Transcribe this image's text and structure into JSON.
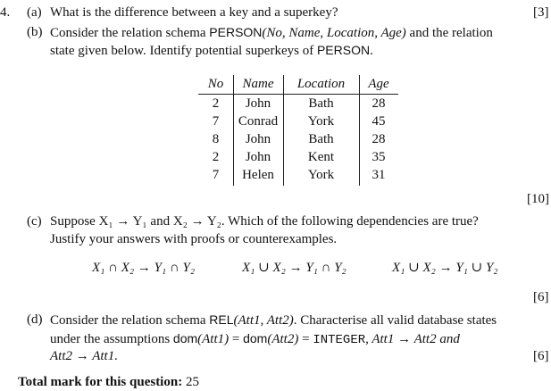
{
  "question": {
    "number": "4.",
    "parts": [
      {
        "label": "(a)",
        "lines": [
          "What is the difference between a key and a superkey?"
        ],
        "marks": "[3]"
      },
      {
        "label": "(b)",
        "line1_pre": "Consider the relation schema ",
        "line1_schema": "PERSON",
        "line1_args": "(No, Name, Location, Age)",
        "line1_post": " and the relation",
        "line2_pre": "state given below. Identify potential superkeys of ",
        "line2_schema": "PERSON",
        "line2_post": ".",
        "marks": "[10]"
      },
      {
        "label": "(c)",
        "line1": "Suppose X₁ → Y₁ and X₂ → Y₂. Which of the following dependencies are true?",
        "line2": "Justify your answers with proofs or counterexamples.",
        "dependencies": [
          "X₁ ∩ X₂ → Y₁ ∩ Y₂",
          "X₁ ∪ X₂ → Y₁ ∩ Y₂",
          "X₁ ∪ X₂ → Y₁ ∪ Y₂"
        ],
        "marks": "[6]"
      },
      {
        "label": "(d)",
        "line1_pre": "Consider the relation schema ",
        "line1_schema": "REL",
        "line1_args": "(Att1, Att2)",
        "line1_post": ". Characterise all valid database states",
        "line2_pre": "under the assumptions ",
        "line2_dom1": "dom",
        "line2_arg1": "(Att1)",
        "line2_eq": " = ",
        "line2_dom2": "dom",
        "line2_arg2": "(Att2)",
        "line2_eq2": " = ",
        "line2_type": "INTEGER",
        "line2_post": ", Att1 → Att2 and",
        "line3": "Att2 → Att1.",
        "marks": "[6]"
      }
    ],
    "table": {
      "headers": [
        "No",
        "Name",
        "Location",
        "Age"
      ],
      "rows": [
        [
          "2",
          "John",
          "Bath",
          "28"
        ],
        [
          "7",
          "Conrad",
          "York",
          "45"
        ],
        [
          "8",
          "John",
          "Bath",
          "28"
        ],
        [
          "2",
          "John",
          "Kent",
          "35"
        ],
        [
          "7",
          "Helen",
          "York",
          "31"
        ]
      ]
    },
    "total_label": "Total mark for this question:",
    "total_value": "25"
  }
}
